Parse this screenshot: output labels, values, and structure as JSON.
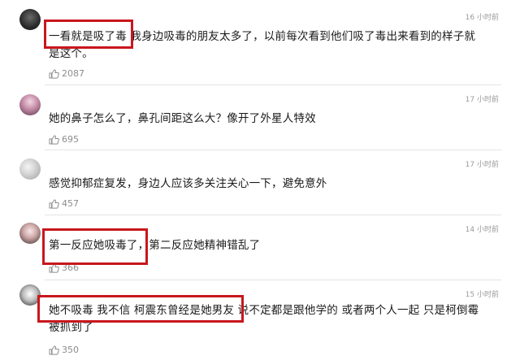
{
  "comments": [
    {
      "time": "16 小时前",
      "text_line1": "一看就是吸了毒   我身边吸毒的朋友太多了，以前每次看到他们吸了毒出来看到的样子就",
      "text_line2": "是这个。",
      "likes": "2087",
      "avatar": "dark-avatar"
    },
    {
      "time": "17 小时前",
      "text_line1": "她的鼻子怎么了，鼻孔间距这么大？像开了外星人特效",
      "likes": "695",
      "avatar": "girl-avatar"
    },
    {
      "time": "17 小时前",
      "text_line1": "感觉抑郁症复发，身边人应该多关注关心一下，避免意外",
      "likes": "457",
      "avatar": "flower-avatar"
    },
    {
      "time": "14 小时前",
      "text_line1": "第一反应她吸毒了，第二反应她精神错乱了",
      "likes": "366",
      "avatar": "woman-avatar"
    },
    {
      "time": "15 小时前",
      "text_line1": "她不吸毒 我不信 柯震东曾经是她男友 说不定都是跟他学的 或者两个人一起 只是柯倒霉",
      "text_line2": "被抓到了",
      "likes": "350",
      "avatar": "anime-avatar"
    }
  ],
  "colors": {
    "highlight": "#c8171d",
    "meta": "#9a9a9a",
    "divider": "#e4e4e4"
  }
}
